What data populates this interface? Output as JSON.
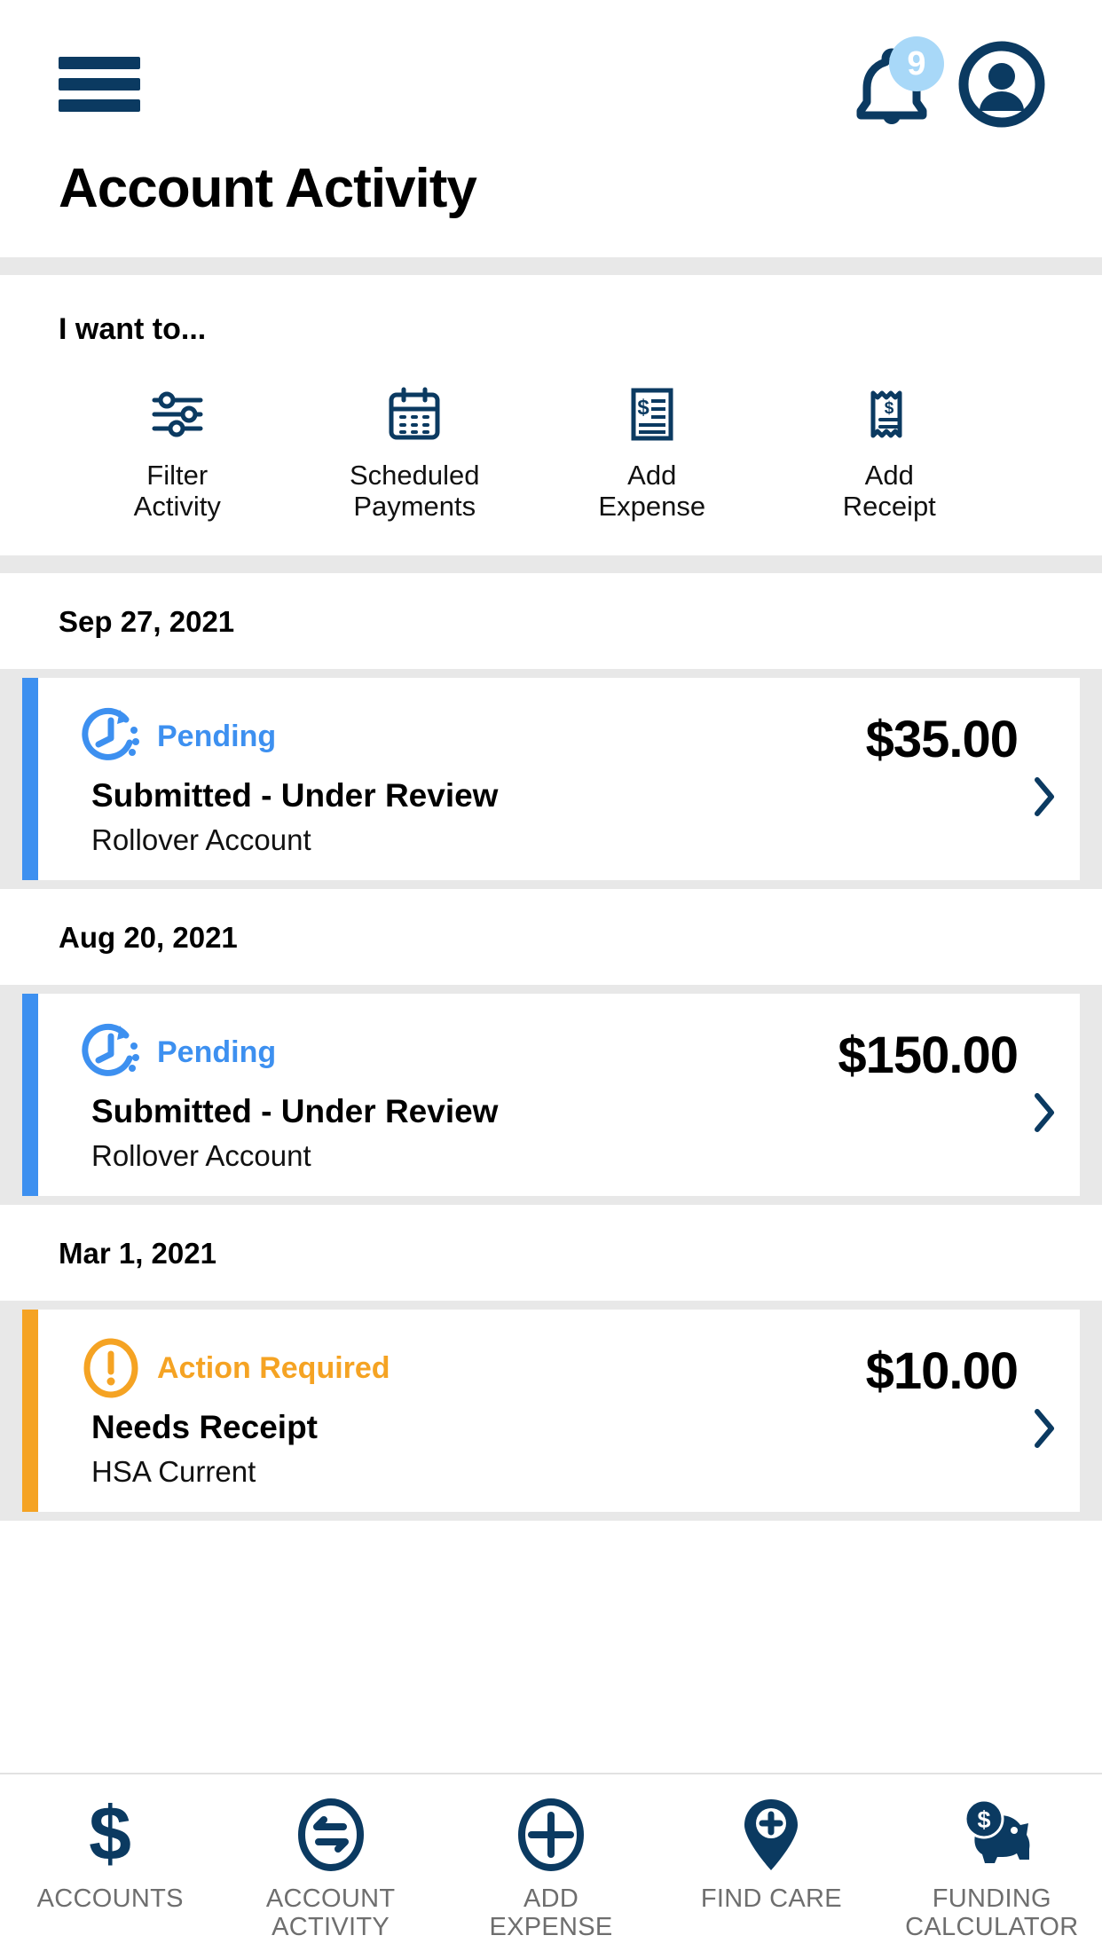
{
  "header": {
    "menu_icon": "hamburger-menu-icon",
    "notification_icon": "bell-icon",
    "notification_count": "9",
    "profile_icon": "user-avatar-icon",
    "page_title": "Account Activity"
  },
  "quick_actions": {
    "label": "I want to...",
    "items": [
      {
        "icon": "sliders-filter-icon",
        "line1": "Filter",
        "line2": "Activity"
      },
      {
        "icon": "calendar-icon",
        "line1": "Scheduled",
        "line2": "Payments"
      },
      {
        "icon": "document-dollar-icon",
        "line1": "Add",
        "line2": "Expense"
      },
      {
        "icon": "receipt-icon",
        "line1": "Add",
        "line2": "Receipt"
      }
    ]
  },
  "activity": {
    "groups": [
      {
        "date": "Sep 27, 2021",
        "transactions": [
          {
            "status": "Pending",
            "status_type": "pending",
            "status_icon": "clock-pending-icon",
            "title": "Submitted - Under Review",
            "account": "Rollover Account",
            "amount": "$35.00",
            "chevron": "chevron-right-icon"
          }
        ]
      },
      {
        "date": "Aug 20, 2021",
        "transactions": [
          {
            "status": "Pending",
            "status_type": "pending",
            "status_icon": "clock-pending-icon",
            "title": "Submitted - Under Review",
            "account": "Rollover Account",
            "amount": "$150.00",
            "chevron": "chevron-right-icon"
          }
        ]
      },
      {
        "date": "Mar 1, 2021",
        "transactions": [
          {
            "status": "Action Required",
            "status_type": "action",
            "status_icon": "exclamation-circle-icon",
            "title": "Needs Receipt",
            "account": "HSA Current",
            "amount": "$10.00",
            "chevron": "chevron-right-icon"
          }
        ]
      }
    ]
  },
  "bottom_nav": {
    "items": [
      {
        "icon": "dollar-sign-icon",
        "line1": "ACCOUNTS",
        "line2": ""
      },
      {
        "icon": "transfer-circle-icon",
        "line1": "ACCOUNT",
        "line2": "ACTIVITY"
      },
      {
        "icon": "plus-circle-icon",
        "line1": "ADD",
        "line2": "EXPENSE"
      },
      {
        "icon": "map-pin-plus-icon",
        "line1": "FIND CARE",
        "line2": ""
      },
      {
        "icon": "piggy-bank-icon",
        "line1": "FUNDING",
        "line2": "CALCULATOR"
      }
    ]
  },
  "colors": {
    "brand_navy": "#0b3a61",
    "pending_blue": "#3d90f0",
    "action_orange": "#f5a323",
    "badge_blue": "#a8d8f8",
    "band_gray": "#e8e8e8",
    "nav_label_gray": "#6e6e6e"
  }
}
